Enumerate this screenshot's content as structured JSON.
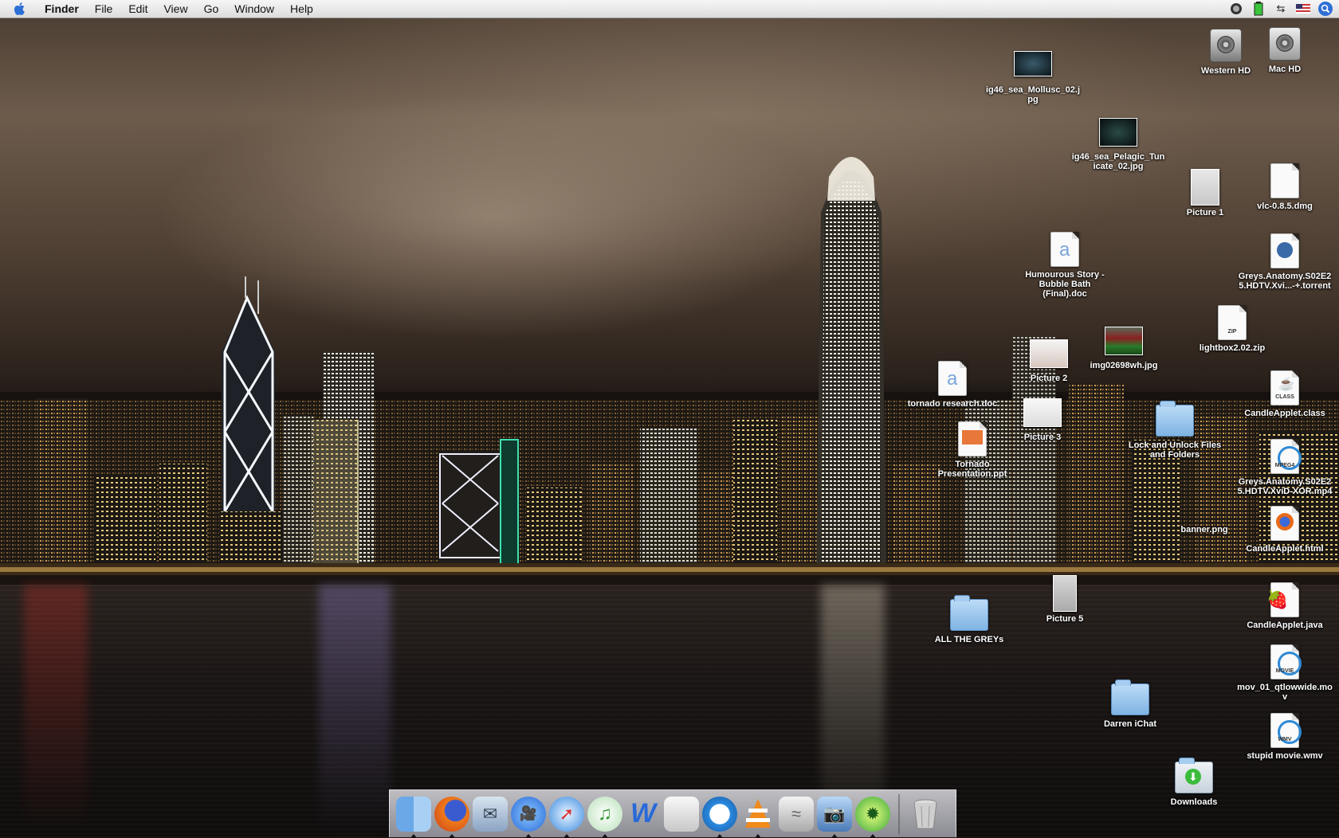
{
  "menubar": {
    "app_name": "Finder",
    "items": [
      "File",
      "Edit",
      "View",
      "Go",
      "Window",
      "Help"
    ]
  },
  "menu_right_icons": [
    "timemachine-icon",
    "battery-icon",
    "sync-icon",
    "us-flag-icon",
    "spotlight-icon"
  ],
  "desktop_icons": {
    "western_hd": "Western HD",
    "mac_hd": "Mac HD",
    "mollusc": "ig46_sea_Mollusc_02.jpg",
    "pelagic": "ig46_sea_Pelagic_Tunicate_02.jpg",
    "picture1": "Picture 1",
    "vlc": "vlc-0.8.5.dmg",
    "humourous": "Humourous Story - Bubble Bath (Final).doc",
    "greys_torrent": "Greys.Anatomy.S02E25.HDTV.Xvi...-+.torrent",
    "lightbox": "lightbox2.02.zip",
    "picture2": "Picture 2",
    "img02698": "img02698wh.jpg",
    "tornado_doc": "tornado research.doc",
    "picture3": "Picture 3",
    "candle_class": "CandleApplet.class",
    "tornado_ppt": "Tornado Presentation.ppt",
    "lock_unlock": "Lock and Unlock Files and Folders",
    "greys_mp4": "Greys.Anatomy.S02E25.HDTV.XviD-XOR.mp4",
    "banner": "banner.png",
    "candle_html": "CandleApplet.html",
    "picture5": "Picture 5",
    "all_the_greys": "ALL THE GREYs",
    "candle_java": "CandleApplet.java",
    "mov01": "mov_01_qtlowwide.mov",
    "darren_ichat": "Darren iChat",
    "stupid_movie": "stupid movie.wmv",
    "downloads": "Downloads",
    "badges": {
      "zip": "ZIP",
      "class": "CLASS",
      "mpeg4": "MPEG4",
      "movie": "MOVIE",
      "wmv": "WMV"
    }
  },
  "dock": {
    "items": [
      "finder-icon",
      "firefox-icon",
      "mail-icon",
      "ichat-icon",
      "safari-icon",
      "itunes-icon",
      "word-icon",
      "preview-icon",
      "quicktime-icon",
      "vlc-icon",
      "remote-desktop-icon",
      "iphoto-icon",
      "limewire-icon"
    ],
    "trash": "trash-icon"
  },
  "colors": {
    "menubar_bg": "#e8e8e8",
    "folder_blue": "#8dbbe8",
    "label_text": "#ffffff"
  }
}
